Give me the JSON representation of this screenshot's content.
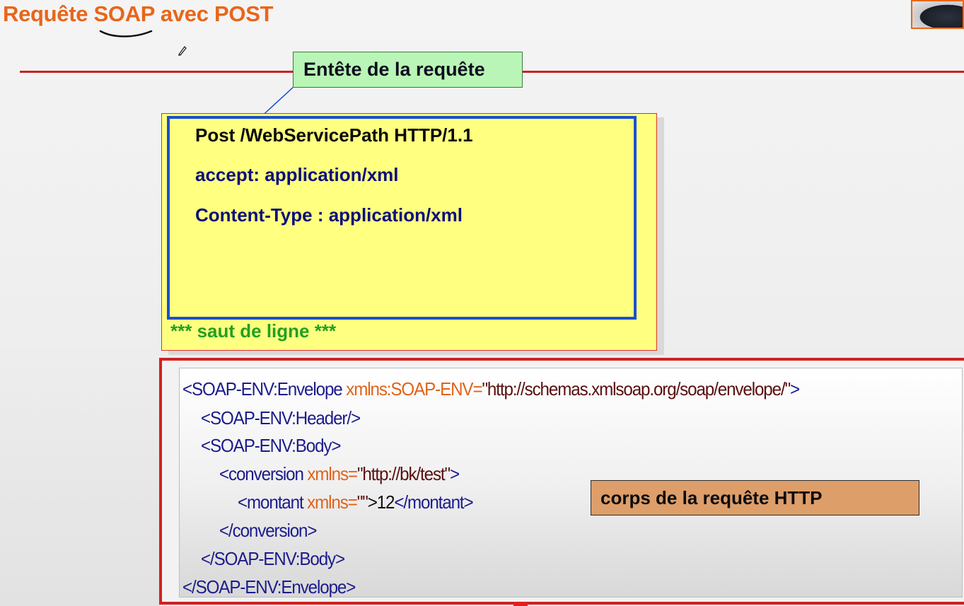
{
  "slide": {
    "title": "Requête SOAP avec POST",
    "accent_color": "#e8661a",
    "rule_color": "#cc2020"
  },
  "header_callout": {
    "label": "Entête de la requête",
    "bg_color": "#b9f5b6"
  },
  "http_header": {
    "bg_color": "#ffff80",
    "border_color": "#1a4fd1",
    "lines": [
      "Post /WebServicePath HTTP/1.1",
      "accept: application/xml",
      "Content-Type : application/xml"
    ],
    "blank_line_label": "*** saut de ligne ***"
  },
  "http_body": {
    "border_color": "#d22020",
    "label": "corps de la requête HTTP",
    "label_bg_color": "#dd9e6a",
    "xml": {
      "l1_tag_open": "<SOAP-ENV:Envelope ",
      "l1_attr": "xmlns:SOAP-ENV=",
      "l1_val": "\"http://schemas.xmlsoap.org/soap/envelope/\"",
      "l1_close": ">",
      "l2": "<SOAP-ENV:Header/>",
      "l3": "<SOAP-ENV:Body>",
      "l4_tag_open": "<conversion ",
      "l4_attr": "xmlns=",
      "l4_val": "\"http://bk/test\"",
      "l4_close": ">",
      "l5_tag_open": "<montant ",
      "l5_attr": "xmlns=",
      "l5_val": "\"\"",
      "l5_text": ">12",
      "l5_close": "</montant>",
      "l6": "</conversion>",
      "l7": "</SOAP-ENV:Body>",
      "l8": "</SOAP-ENV:Envelope>"
    }
  },
  "icons": {
    "pen_annotation": "underline-pen-stroke",
    "cursor": "pen-cursor-icon",
    "webcam": "webcam-thumbnail"
  }
}
